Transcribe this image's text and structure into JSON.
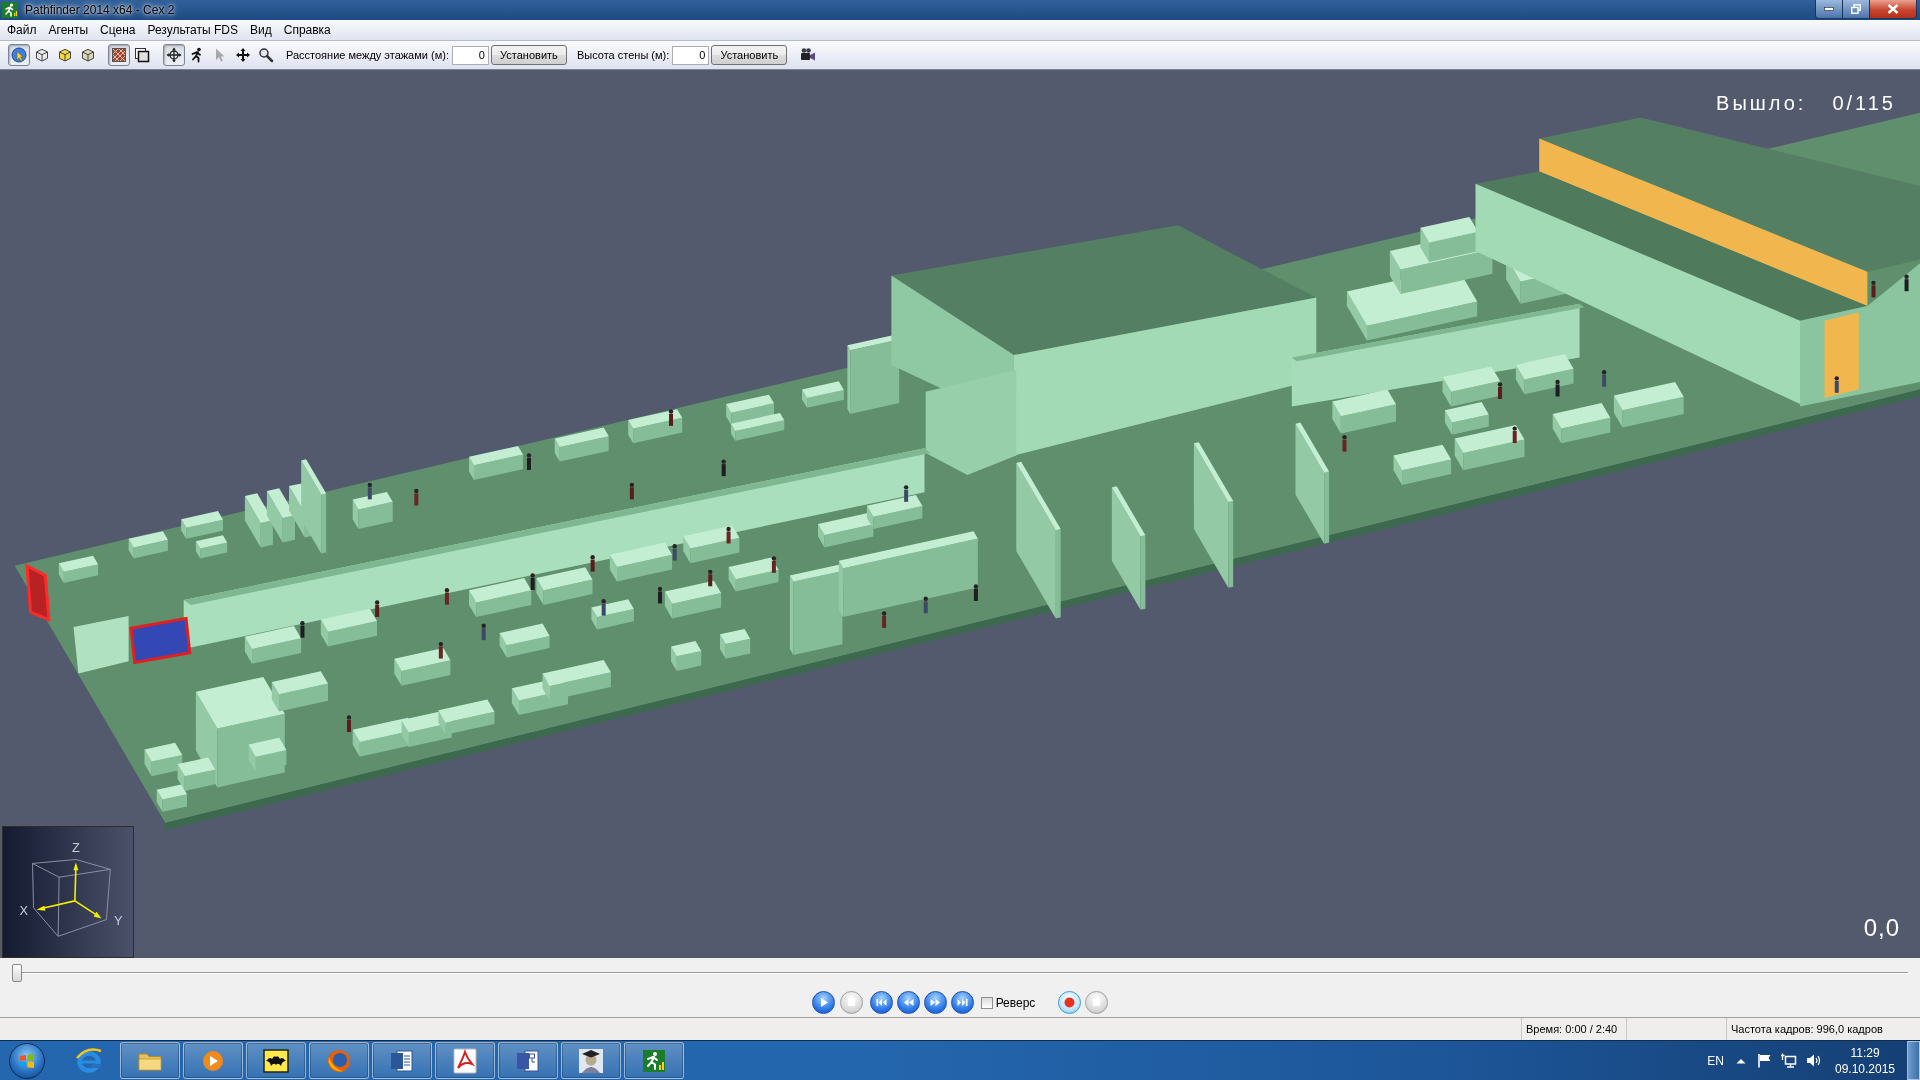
{
  "window": {
    "title": "Pathfinder 2014 x64 - Cex 2"
  },
  "menu": [
    "Файл",
    "Агенты",
    "Сцена",
    "Результаты FDS",
    "Вид",
    "Справка"
  ],
  "toolbar": {
    "tool_groups": [
      {
        "tools": [
          {
            "selected": true,
            "disabled": false
          },
          {
            "selected": false,
            "disabled": false
          },
          {
            "selected": false,
            "disabled": false
          },
          {
            "selected": false,
            "disabled": false
          }
        ]
      },
      {
        "tools": [
          {
            "selected": true,
            "disabled": false
          },
          {
            "selected": false,
            "disabled": false
          }
        ]
      },
      {
        "tools": [
          {
            "selected": true,
            "disabled": false
          },
          {
            "selected": false,
            "disabled": false
          },
          {
            "selected": false,
            "disabled": true
          },
          {
            "selected": false,
            "disabled": false
          },
          {
            "selected": false,
            "disabled": false
          }
        ]
      }
    ],
    "fields": [
      {
        "label": "Расстояние между этажами (м):",
        "value": "0",
        "button": "Установить"
      },
      {
        "label": "Высота стены (м):",
        "value": "0",
        "button": "Установить"
      }
    ]
  },
  "viewport": {
    "exited_label": "Вышло:",
    "exited_count": "0/115",
    "frame_readout": "0,0",
    "axis_labels": {
      "z": "Z",
      "x": "X",
      "y": "Y"
    }
  },
  "timeline": {
    "level": 0
  },
  "playback": {
    "buttons": [
      {
        "disabled": false
      },
      {
        "disabled": true
      },
      {
        "disabled": false
      },
      {
        "disabled": false
      },
      {
        "disabled": false
      },
      {
        "disabled": false
      }
    ],
    "reverse": {
      "label": "Реверс",
      "checked": false
    },
    "record_buttons": [
      {
        "disabled": false
      },
      {
        "disabled": true
      }
    ]
  },
  "status_bar": {
    "time": "Время: 0:00 / 2:40",
    "frame_rate": "Частота кадров: 996,0 кадров"
  },
  "taskbar": {
    "tray": {
      "language": "EN",
      "time": "11:29",
      "date": "09.10.2015"
    }
  }
}
